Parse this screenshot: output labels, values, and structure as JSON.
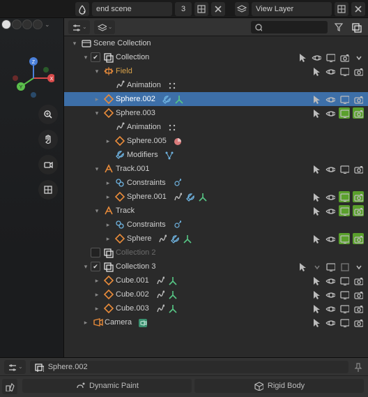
{
  "header": {
    "scene_name": "end scene",
    "scene_users": "3",
    "view_layer": "View Layer"
  },
  "outliner": {
    "search_placeholder": "",
    "rows": [
      {
        "id": "scene-collection",
        "depth": 0,
        "disclose": "open",
        "check": null,
        "icon": "scene",
        "label": "Scene Collection",
        "mods": [],
        "right": [],
        "muted": false
      },
      {
        "id": "collection",
        "depth": 1,
        "disclose": "open",
        "check": "on",
        "icon": "collection",
        "label": "Collection",
        "mods": [],
        "right": [
          "cursor",
          "eye",
          "screen",
          "camera",
          "chev"
        ],
        "muted": false
      },
      {
        "id": "field",
        "depth": 2,
        "disclose": "open",
        "check": null,
        "icon": "field",
        "label": "Field",
        "mods": [],
        "right": [
          "cursor",
          "eye",
          "screen",
          "camera"
        ],
        "muted": false,
        "emph": true
      },
      {
        "id": "field-anim",
        "depth": 3,
        "disclose": "none",
        "check": null,
        "icon": "anim",
        "label": "Animation",
        "mods": [
          "dots"
        ],
        "right": [],
        "muted": false
      },
      {
        "id": "sphere-002",
        "depth": 2,
        "disclose": "closed",
        "check": null,
        "icon": "mesh",
        "label": "Sphere.002",
        "mods": [
          "wrench",
          "y"
        ],
        "right": [
          "cursor",
          "eye",
          "screen",
          "camera"
        ],
        "muted": false,
        "selected": true,
        "emph": true
      },
      {
        "id": "sphere-003",
        "depth": 2,
        "disclose": "open",
        "check": null,
        "icon": "mesh",
        "label": "Sphere.003",
        "mods": [],
        "right": [
          "cursor",
          "eye",
          "screen-g",
          "camera-g"
        ],
        "muted": false
      },
      {
        "id": "sphere-003-anim",
        "depth": 3,
        "disclose": "none",
        "check": null,
        "icon": "anim",
        "label": "Animation",
        "mods": [
          "dots"
        ],
        "right": [],
        "muted": false
      },
      {
        "id": "sphere-005",
        "depth": 3,
        "disclose": "closed",
        "check": null,
        "icon": "mesh",
        "label": "Sphere.005",
        "mods": [
          "circle"
        ],
        "right": [],
        "muted": false
      },
      {
        "id": "modifiers",
        "depth": 3,
        "disclose": "none",
        "check": null,
        "icon": "wrench",
        "label": "Modifiers",
        "mods": [
          "flow"
        ],
        "right": [],
        "muted": false
      },
      {
        "id": "track-001",
        "depth": 2,
        "disclose": "open",
        "check": null,
        "icon": "track",
        "label": "Track.001",
        "mods": [],
        "right": [
          "cursor",
          "eye",
          "screen",
          "camera"
        ],
        "muted": false
      },
      {
        "id": "track-001-con",
        "depth": 3,
        "disclose": "closed",
        "check": null,
        "icon": "link",
        "label": "Constraints",
        "mods": [
          "plus"
        ],
        "right": [],
        "muted": false
      },
      {
        "id": "sphere-001",
        "depth": 3,
        "disclose": "closed",
        "check": null,
        "icon": "mesh",
        "label": "Sphere.001",
        "mods": [
          "anim",
          "wrench",
          "y"
        ],
        "right": [
          "cursor",
          "eye",
          "screen-g",
          "camera-g"
        ],
        "muted": false
      },
      {
        "id": "track",
        "depth": 2,
        "disclose": "open",
        "check": null,
        "icon": "track",
        "label": "Track",
        "mods": [],
        "right": [
          "cursor",
          "eye",
          "screen-g",
          "camera-g"
        ],
        "muted": false
      },
      {
        "id": "track-con",
        "depth": 3,
        "disclose": "closed",
        "check": null,
        "icon": "link",
        "label": "Constraints",
        "mods": [
          "plus"
        ],
        "right": [],
        "muted": false
      },
      {
        "id": "sphere",
        "depth": 3,
        "disclose": "closed",
        "check": null,
        "icon": "mesh",
        "label": "Sphere",
        "mods": [
          "anim",
          "wrench",
          "y"
        ],
        "right": [
          "cursor",
          "eye",
          "screen-g",
          "camera-g"
        ],
        "muted": false
      },
      {
        "id": "collection-2",
        "depth": 1,
        "disclose": "none",
        "check": "off",
        "icon": "collection",
        "label": "Collection 2",
        "mods": [],
        "right": [],
        "muted": true
      },
      {
        "id": "collection-3",
        "depth": 1,
        "disclose": "open",
        "check": "on",
        "icon": "collection",
        "label": "Collection 3",
        "mods": [],
        "right": [
          "cursor",
          "chevd",
          "screen",
          "box",
          "chev"
        ],
        "muted": false
      },
      {
        "id": "cube-001",
        "depth": 2,
        "disclose": "closed",
        "check": null,
        "icon": "mesh",
        "label": "Cube.001",
        "mods": [
          "anim",
          "y"
        ],
        "right": [
          "cursor",
          "eye",
          "screen",
          "camera"
        ],
        "muted": false
      },
      {
        "id": "cube-002",
        "depth": 2,
        "disclose": "closed",
        "check": null,
        "icon": "mesh",
        "label": "Cube.002",
        "mods": [
          "anim",
          "y"
        ],
        "right": [
          "cursor",
          "eye",
          "screen",
          "camera"
        ],
        "muted": false
      },
      {
        "id": "cube-003",
        "depth": 2,
        "disclose": "closed",
        "check": null,
        "icon": "mesh",
        "label": "Cube.003",
        "mods": [
          "anim",
          "y"
        ],
        "right": [
          "cursor",
          "eye",
          "screen",
          "camera"
        ],
        "muted": false
      },
      {
        "id": "camera",
        "depth": 1,
        "disclose": "closed",
        "check": null,
        "icon": "camera",
        "label": "Camera",
        "mods": [
          "cam-badge"
        ],
        "right": [
          "cursor",
          "eye",
          "screen",
          "camera"
        ],
        "muted": false
      }
    ]
  },
  "properties": {
    "context_name": "Sphere.002",
    "tabs": {
      "dynamic_paint": "Dynamic Paint",
      "rigid_body": "Rigid Body"
    }
  }
}
